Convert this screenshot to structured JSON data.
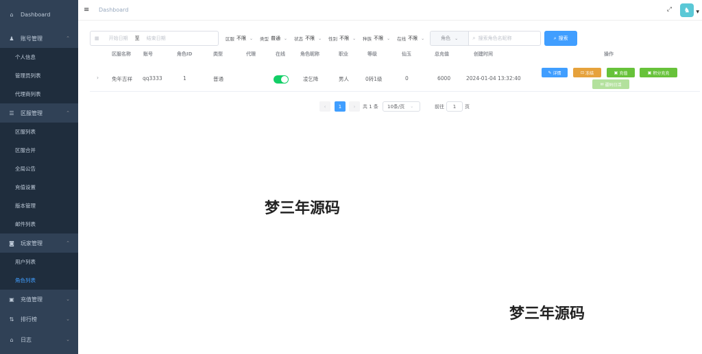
{
  "sidebar": {
    "dashboard": "Dashboard",
    "account_mgmt": "账号管理",
    "personal_info": "个人信息",
    "admin_list": "管理员列表",
    "agent_list": "代理商列表",
    "server_mgmt": "区服管理",
    "server_list": "区服列表",
    "server_merge": "区服合并",
    "announcement": "全局公告",
    "recharge_settings": "充值设置",
    "version_mgmt": "版本管理",
    "mail_list": "邮件列表",
    "player_mgmt": "玩家管理",
    "user_list": "用户列表",
    "role_list": "角色列表",
    "recharge_mgmt": "充值管理",
    "leaderboard": "排行榜",
    "logs": "日志"
  },
  "header": {
    "breadcrumb": "Dashboard"
  },
  "filters": {
    "start_date": "开始日期",
    "date_sep": "至",
    "end_date": "结束日期",
    "server_label": "区服",
    "server_value": "不限",
    "type_label": "类型",
    "type_value": "普通",
    "status_label": "状态",
    "status_value": "不限",
    "gender_label": "性别",
    "gender_value": "不限",
    "rebirth_label": "种族",
    "rebirth_value": "不限",
    "online_label": "在线",
    "online_value": "不限",
    "role_select": "角色",
    "search_placeholder": "搜索角色名昵称",
    "search_button": "搜索"
  },
  "table": {
    "headers": [
      "区服名称",
      "账号",
      "角色ID",
      "类型",
      "代理",
      "在线",
      "角色昵称",
      "职业",
      "等级",
      "仙玉",
      "总充值",
      "创建时间",
      "操作"
    ],
    "row": {
      "server": "免年吉祥",
      "account": "qq3333",
      "role_id": "1",
      "type": "普通",
      "agent": "",
      "online": true,
      "nickname": "凌乞降",
      "profession": "男人",
      "level": "0转1级",
      "jade": "0",
      "recharge": "6000",
      "created": "2024-01-04 13:32:40"
    },
    "actions": {
      "detail": "详情",
      "freeze": "冻结",
      "recharge": "充值",
      "points": "积分充充",
      "repair": "疆码日活"
    }
  },
  "pagination": {
    "current": "1",
    "total": "共 1 条",
    "page_size": "10条/页",
    "goto_label": "前往",
    "goto_value": "1",
    "page_suffix": "页"
  },
  "watermarks": [
    "梦三年源码",
    "梦三年源码"
  ],
  "colors": {
    "sidebar_bg": "#304156",
    "primary": "#409eff",
    "warning": "#e6a23c",
    "success": "#67c23a",
    "switch_on": "#13ce66"
  }
}
